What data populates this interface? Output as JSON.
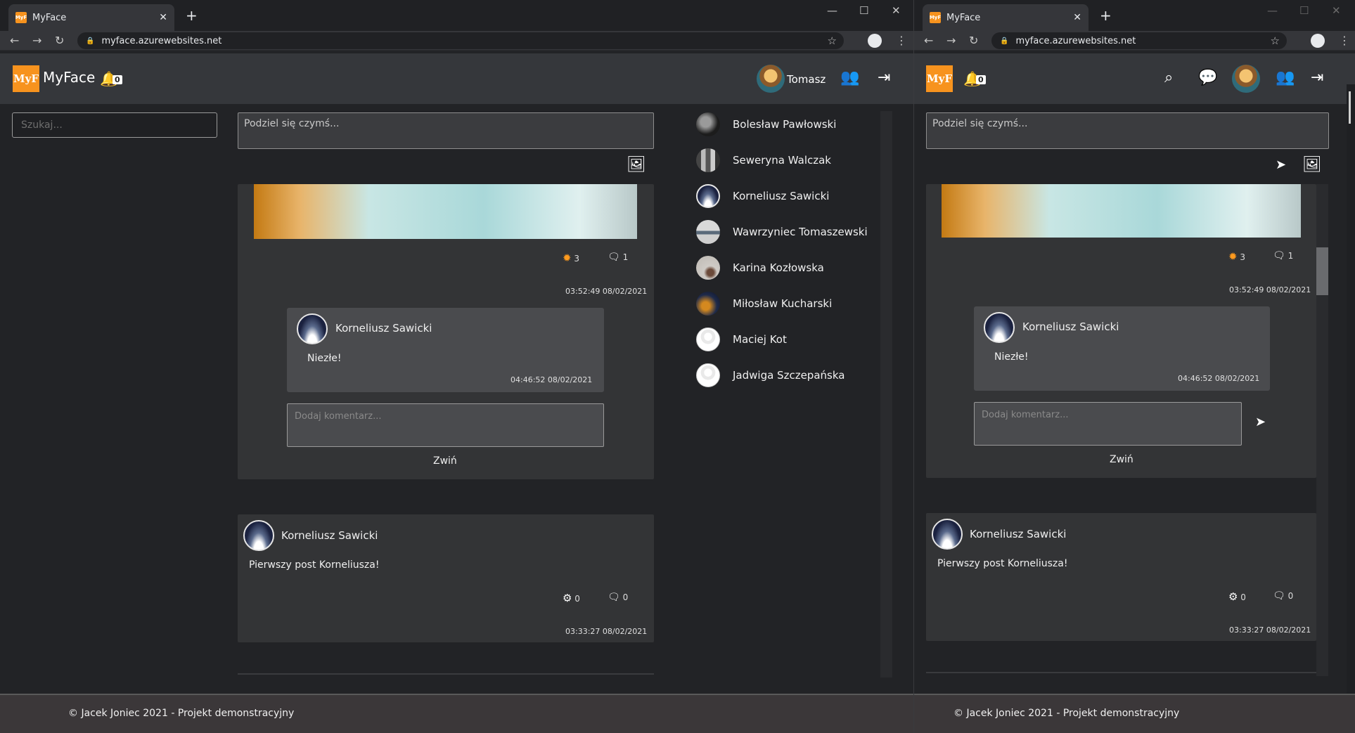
{
  "browser": {
    "tab_title": "MyFace",
    "favicon_text": "MyF",
    "url": "myface.azurewebsites.net"
  },
  "app": {
    "logo_text": "MyF",
    "brand": "MyFace",
    "notifications_count": "0",
    "username": "Tomasz"
  },
  "search": {
    "placeholder": "Szukaj..."
  },
  "share": {
    "placeholder": "Podziel się czymś..."
  },
  "posts": [
    {
      "likes": "3",
      "comments_count": "1",
      "timestamp": "03:52:49 08/02/2021",
      "comment": {
        "author": "Korneliusz Sawicki",
        "text": "Niezłe!",
        "timestamp": "04:46:52 08/02/2021"
      },
      "comment_placeholder": "Dodaj komentarz...",
      "collapse_label": "Zwiń"
    },
    {
      "author": "Korneliusz Sawicki",
      "text": "Pierwszy post Korneliusza!",
      "likes": "0",
      "comments_count": "0",
      "timestamp": "03:33:27 08/02/2021"
    }
  ],
  "friends": [
    {
      "name": "Bolesław Pawłowski"
    },
    {
      "name": "Seweryna Walczak"
    },
    {
      "name": "Korneliusz Sawicki"
    },
    {
      "name": "Wawrzyniec Tomaszewski"
    },
    {
      "name": "Karina Kozłowska"
    },
    {
      "name": "Miłosław Kucharski"
    },
    {
      "name": "Maciej Kot"
    },
    {
      "name": "Jadwiga Szczepańska"
    }
  ],
  "footer": {
    "text": "© Jacek Joniec 2021 - Projekt demonstracyjny"
  },
  "icons": {
    "bell": "bell-icon",
    "users": "users-icon",
    "logout": "logout-icon",
    "image": "image-icon",
    "like": "gear-icon",
    "comment": "comment-icon",
    "send": "send-icon",
    "search": "search-icon",
    "chat": "chat-icon"
  },
  "colors": {
    "accent": "#f7931e",
    "navbar": "#35373b",
    "background": "#222326",
    "card": "#333436"
  }
}
